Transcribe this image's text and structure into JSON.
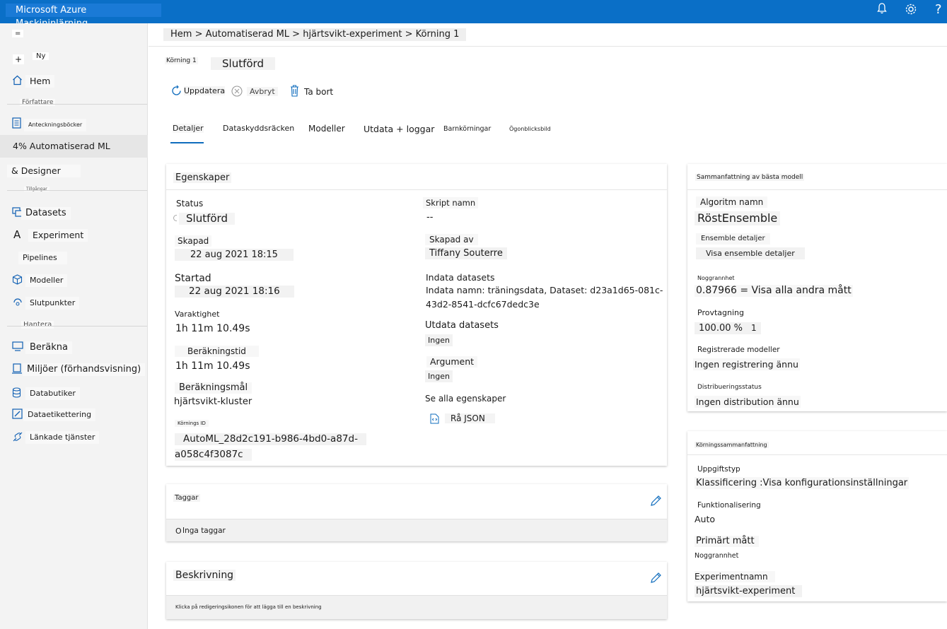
{
  "topbar": {
    "title": "Microsoft Azure Maskininlärning",
    "bell_icon": "bell-icon",
    "settings_icon": "gear-icon",
    "help_label": "?"
  },
  "sidebar": {
    "menu_label": "=",
    "new_label": "Ny",
    "new_icon_label": "+",
    "home_label": "Hem",
    "author_head": "Författare",
    "notebooks_label": "Anteckningsböcker",
    "automl_label": "4% Automatiserad ML",
    "designer_label": "& Designer",
    "assets_head": "Tillgångar",
    "datasets_label": "Datasets",
    "experiments_icon_label": "A",
    "experiments_label": "Experiment",
    "pipelines_label": "Pipelines",
    "models_label": "Modeller",
    "endpoints_label": "Slutpunkter",
    "manage_head": "Hantera",
    "compute_label": "Beräkna",
    "environments_label": "Miljöer (förhandsvisning)",
    "datastores_label": "Databutiker",
    "labeling_label": "Dataetikettering",
    "linked_label": "Länkade tjänster"
  },
  "breadcrumb": "Hem > Automatiserad ML > hjärtsvikt-experiment > Körning 1",
  "run": {
    "name": "Körning 1",
    "status": "Slutförd"
  },
  "toolbar": {
    "refresh": "Uppdatera",
    "cancel": "Avbryt",
    "delete": "Ta bort"
  },
  "tabs": [
    "Detaljer",
    "Dataskyddsräcken",
    "Modeller",
    "Utdata + loggar",
    "Barnkörningar",
    "Ögonblicksbild"
  ],
  "properties": {
    "title": "Egenskaper",
    "status_label": "Status",
    "status_value": "Slutförd",
    "created_label": "Skapad",
    "created_value": "22 aug 2021 18:15",
    "started_label": "Startad",
    "started_value": "22 aug 2021 18:16",
    "duration_label": "Varaktighet",
    "duration_value": "1h 11m 10.49s",
    "compute_time_label": "Beräkningstid",
    "compute_time_value": "1h 11m 10.49s",
    "compute_target_label": "Beräkningsmål",
    "compute_target_value": "hjärtsvikt-kluster",
    "run_id_label": "Körnings ID",
    "run_id_value_1": "AutoML_28d2c191-b986-4bd0-a87d-",
    "run_id_value_2": "a058c4f3087c",
    "script_label": "Skript namn",
    "script_value": "--",
    "created_by_label": "Skapad av",
    "created_by_value": "Tiffany Souterre",
    "input_label": "Indata datasets",
    "input_value_1": "Indata namn: träningsdata, Dataset: d23a1d65-081c-",
    "input_value_2": "43d2-8541-dcfc67dedc3e",
    "output_label": "Utdata datasets",
    "output_value": "Ingen",
    "args_label": "Argument",
    "args_value": "Ingen",
    "see_all": "Se alla egenskaper",
    "raw_json": "Rå JSON"
  },
  "tags": {
    "title": "Taggar",
    "empty": "Inga taggar",
    "empty_prefix": "O"
  },
  "description": {
    "title": "Beskrivning",
    "hint": "Klicka på redigeringsikonen för att lägga till en beskrivning"
  },
  "best_model": {
    "title": "Sammanfattning av bästa modell",
    "algo_label": "Algoritm namn",
    "algo_value": "RöstEnsemble",
    "ensemble_label": "Ensemble detaljer",
    "ensemble_link": "Visa ensemble detaljer",
    "accuracy_label": "Noggrannhet",
    "accuracy_value": "0.87966 = Visa alla andra mått",
    "sampling_label": "Provtagning",
    "sampling_value": "100.00 %",
    "sampling_info": "1",
    "registered_label": "Registrerade modeller",
    "registered_value": "Ingen registrering ännu",
    "deploy_label": "Distribueringsstatus",
    "deploy_value": "Ingen distribution ännu"
  },
  "run_summary": {
    "title": "Körningssammanfattning",
    "task_label": "Uppgiftstyp",
    "task_value": "Klassificering :Visa konfigurationsinställningar",
    "feat_label": "Funktionalisering",
    "feat_value": "Auto",
    "metric_label": "Primärt mått",
    "metric_value": "Noggrannhet",
    "exp_label": "Experimentnamn",
    "exp_value": "hjärtsvikt-experiment"
  }
}
